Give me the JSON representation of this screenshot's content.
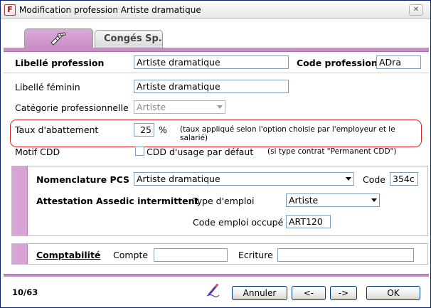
{
  "window": {
    "title": "Modification profession Artiste dramatique",
    "close_symbol": "✕"
  },
  "tabs": {
    "main_icon": "clapperboard-icon",
    "conges_label": "Congés Sp."
  },
  "form": {
    "libelle_label": "Libellé profession",
    "libelle_value": "Artiste dramatique",
    "code_label": "Code profession",
    "code_value": "ADra",
    "feminin_label": "Libellé féminin",
    "feminin_value": "Artiste dramatique",
    "categorie_label": "Catégorie professionnelle",
    "categorie_value": "Artiste",
    "taux_label": "Taux d'abattement",
    "taux_value": "25",
    "taux_unit": "%",
    "taux_note_line1": "(taux appliqué selon l'option choisie par l'employeur et le",
    "taux_note_line2": "salarié)",
    "motif_label": "Motif CDD",
    "cdd_checkbox_label": "CDD d'usage par défaut",
    "cdd_note": "(si type contrat \"Permanent CDD\")"
  },
  "nomenclature": {
    "pcs_label": "Nomenclature PCS",
    "pcs_value": "Artiste dramatique",
    "code_label": "Code",
    "code_value": "354c",
    "attestation_label": "Attestation Assedic intermittent",
    "type_emploi_label": "Type d'emploi",
    "type_emploi_value": "Artiste",
    "code_emploi_label": "Code emploi occupé",
    "code_emploi_value": "ART120"
  },
  "comptabilite": {
    "title": "Comptabilité",
    "compte_label": "Compte",
    "compte_value": "",
    "ecriture_label": "Ecriture",
    "ecriture_value": ""
  },
  "footer": {
    "record_counter": "10/63",
    "annuler_label": "Annuler",
    "prev_label": "<-",
    "next_label": "->",
    "ok_label": "OK"
  }
}
